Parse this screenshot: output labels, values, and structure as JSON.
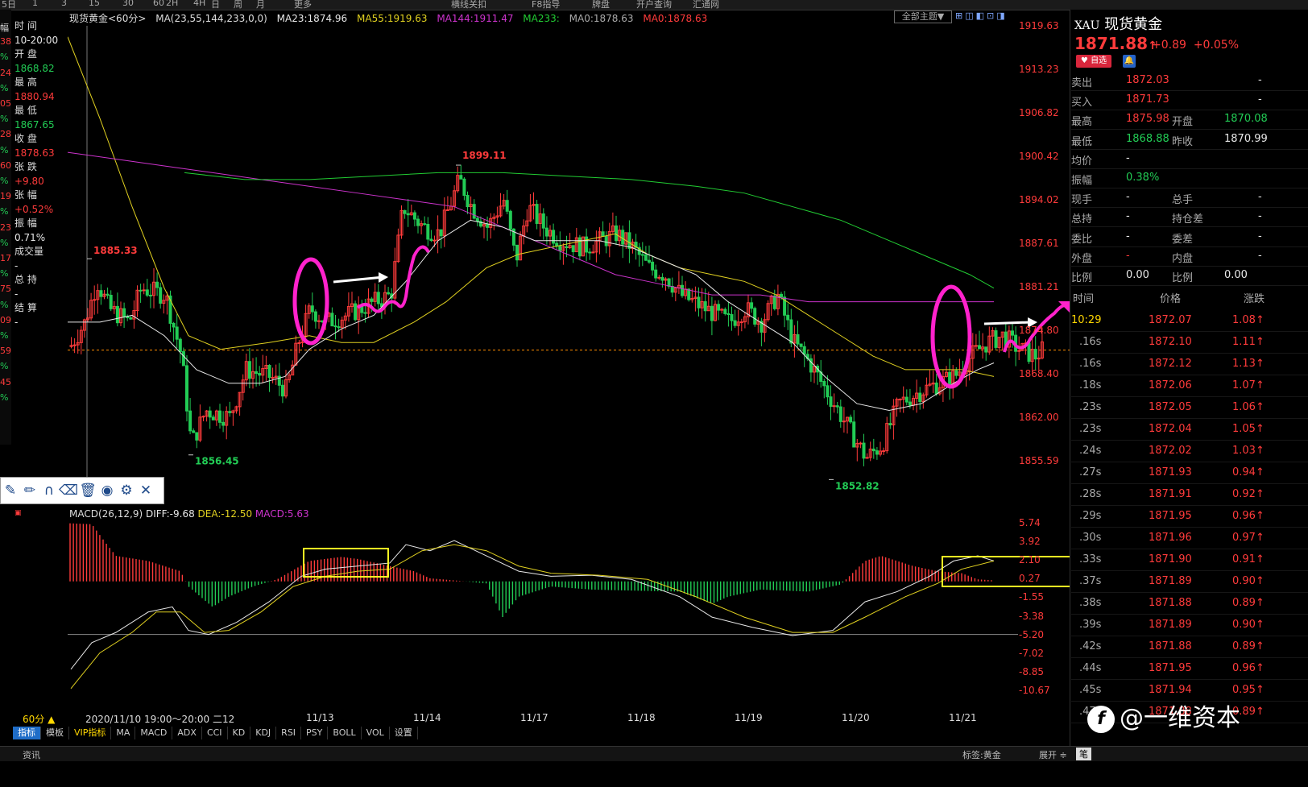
{
  "toolbar": {
    "items": [
      "5日",
      "1",
      "3",
      "15",
      "30",
      "60",
      "2H",
      "4H",
      "日",
      "周",
      "月",
      "更多",
      "横线关扣",
      "F8指导",
      "牌盘",
      "开户查询",
      "汇通网"
    ]
  },
  "left_fragments": [
    "幅",
    "38",
    "%",
    "24",
    "%",
    "05",
    "%",
    "28",
    "%",
    "60",
    "%",
    "19",
    "%",
    "23",
    "%",
    "17",
    "%",
    "75",
    "%",
    "09",
    "%",
    "59",
    "%",
    "45",
    "%"
  ],
  "info": [
    {
      "label": "时 间",
      "value": "10-20:00",
      "cls": "white"
    },
    {
      "label": "开 盘",
      "value": "1868.82",
      "cls": "green"
    },
    {
      "label": "最 高",
      "value": "1880.94",
      "cls": "red"
    },
    {
      "label": "最 低",
      "value": "1867.65",
      "cls": "green"
    },
    {
      "label": "收 盘",
      "value": "1878.63",
      "cls": "red"
    },
    {
      "label": "张 跌",
      "value": "+9.80",
      "cls": "red"
    },
    {
      "label": "张 幅",
      "value": "+0.52%",
      "cls": "red"
    },
    {
      "label": "振 幅",
      "value": "0.71%",
      "cls": "white"
    },
    {
      "label": "成交量",
      "value": "-",
      "cls": "white"
    },
    {
      "label": "总 持",
      "value": "-",
      "cls": "white"
    },
    {
      "label": "结 算",
      "value": "-",
      "cls": "white"
    }
  ],
  "legend": {
    "name": "现货黄金<60分>",
    "ma_cfg": "MA(23,55,144,233,0,0)",
    "ma23": "MA23:1874.96",
    "ma55": "MA55:1919.63",
    "ma144": "MA144:1911.47",
    "ma233": "MA233:",
    "ma0a": "MA0:1878.63",
    "ma0b": "MA0:1878.63",
    "colors": {
      "ma23": "#e8e8e8",
      "ma55": "#e0d020",
      "ma144": "#cc33cc",
      "ma233": "#22cc33",
      "ma0a": "#aaaaaa",
      "ma0b": "#ff3b3b"
    }
  },
  "theme_button": "全部主题▼",
  "price_axis": [
    "1919.63",
    "1913.23",
    "1906.82",
    "1900.42",
    "1894.02",
    "1887.61",
    "1881.21",
    "1874.80",
    "1868.40",
    "1862.00",
    "1855.59"
  ],
  "extremes": [
    {
      "price": 1885.33,
      "label": "1885.33",
      "cls": "red"
    },
    {
      "price": 1899.11,
      "label": "1899.11",
      "cls": "red"
    },
    {
      "price": 1856.45,
      "label": "1856.45",
      "cls": "green"
    },
    {
      "price": 1852.82,
      "label": "1852.82",
      "cls": "green"
    }
  ],
  "macd": {
    "title": "MACD(26,12,9)",
    "diff": "DIFF:-9.68",
    "dea": "DEA:-12.50",
    "macd": "MACD:5.63",
    "axis": [
      "5.74",
      "3.92",
      "2.10",
      "0.27",
      "-1.55",
      "-3.38",
      "-5.20",
      "-7.02",
      "-8.85",
      "-10.67"
    ]
  },
  "period": "60分 ▲",
  "dates": [
    "2020/11/10 19:00～20:00 二12",
    "11/13",
    "11/14",
    "11/17",
    "11/18",
    "11/19",
    "11/20",
    "11/21"
  ],
  "tabs": [
    "指标",
    "模板",
    "VIP指标",
    "MA",
    "MACD",
    "ADX",
    "CCI",
    "KD",
    "KDJ",
    "RSI",
    "PSY",
    "BOLL",
    "VOL",
    "设置"
  ],
  "status": {
    "left": "资讯",
    "tag": "标签:黄金",
    "expand": "展开 ≑",
    "mode": "笔"
  },
  "right": {
    "code": "XAU",
    "name": "现货黄金",
    "price": "1871.88",
    "arrow": "↑",
    "change": "+0.89",
    "pct": "+0.05%",
    "fav": "♥ 自选",
    "bell": "🔔",
    "quotes": [
      {
        "k1": "卖出",
        "v1": "1872.03",
        "c1": "red",
        "k2": "",
        "v2": "-",
        "c2": "white"
      },
      {
        "k1": "买入",
        "v1": "1871.73",
        "c1": "red",
        "k2": "",
        "v2": "-",
        "c2": "white"
      },
      {
        "k1": "最高",
        "v1": "1875.98",
        "c1": "red",
        "k2": "开盘",
        "v2": "1870.08",
        "c2": "green"
      },
      {
        "k1": "最低",
        "v1": "1868.88",
        "c1": "green",
        "k2": "昨收",
        "v2": "1870.99",
        "c2": "white"
      },
      {
        "k1": "均价",
        "v1": "-",
        "c1": "white",
        "k2": "",
        "v2": "",
        "c2": "white"
      },
      {
        "k1": "振幅",
        "v1": "0.38%",
        "c1": "green",
        "k2": "",
        "v2": "",
        "c2": "white"
      },
      {
        "k1": "现手",
        "v1": "-",
        "c1": "white",
        "k2": "总手",
        "v2": "-",
        "c2": "white"
      },
      {
        "k1": "总持",
        "v1": "-",
        "c1": "white",
        "k2": "持仓差",
        "v2": "-",
        "c2": "white"
      },
      {
        "k1": "委比",
        "v1": "-",
        "c1": "white",
        "k2": "委差",
        "v2": "-",
        "c2": "white"
      },
      {
        "k1": "外盘",
        "v1": "-",
        "c1": "red",
        "k2": "内盘",
        "v2": "-",
        "c2": "white"
      },
      {
        "k1": "比例",
        "v1": "0.00",
        "c1": "white",
        "k2": "比例",
        "v2": "0.00",
        "c2": "white"
      }
    ],
    "tick_headers": [
      "时间",
      "价格",
      "涨跌"
    ],
    "ticks": [
      {
        "t": "10:29",
        "p": "1872.07",
        "c": "1.08↑"
      },
      {
        "t": ".16s",
        "p": "1872.10",
        "c": "1.11↑"
      },
      {
        "t": ".16s",
        "p": "1872.12",
        "c": "1.13↑"
      },
      {
        "t": ".18s",
        "p": "1872.06",
        "c": "1.07↑"
      },
      {
        "t": ".23s",
        "p": "1872.05",
        "c": "1.06↑"
      },
      {
        "t": ".23s",
        "p": "1872.04",
        "c": "1.05↑"
      },
      {
        "t": ".24s",
        "p": "1872.02",
        "c": "1.03↑"
      },
      {
        "t": ".27s",
        "p": "1871.93",
        "c": "0.94↑"
      },
      {
        "t": ".28s",
        "p": "1871.91",
        "c": "0.92↑"
      },
      {
        "t": ".29s",
        "p": "1871.95",
        "c": "0.96↑"
      },
      {
        "t": ".30s",
        "p": "1871.96",
        "c": "0.97↑"
      },
      {
        "t": ".33s",
        "p": "1871.90",
        "c": "0.91↑"
      },
      {
        "t": ".37s",
        "p": "1871.89",
        "c": "0.90↑"
      },
      {
        "t": ".38s",
        "p": "1871.88",
        "c": "0.89↑"
      },
      {
        "t": ".39s",
        "p": "1871.89",
        "c": "0.90↑"
      },
      {
        "t": ".42s",
        "p": "1871.88",
        "c": "0.89↑"
      },
      {
        "t": ".44s",
        "p": "1871.95",
        "c": "0.96↑"
      },
      {
        "t": ".45s",
        "p": "1871.94",
        "c": "0.95↑"
      },
      {
        "t": ".47s",
        "p": "1871.88",
        "c": "0.89↑"
      }
    ]
  },
  "watermark": "@一维资本"
}
